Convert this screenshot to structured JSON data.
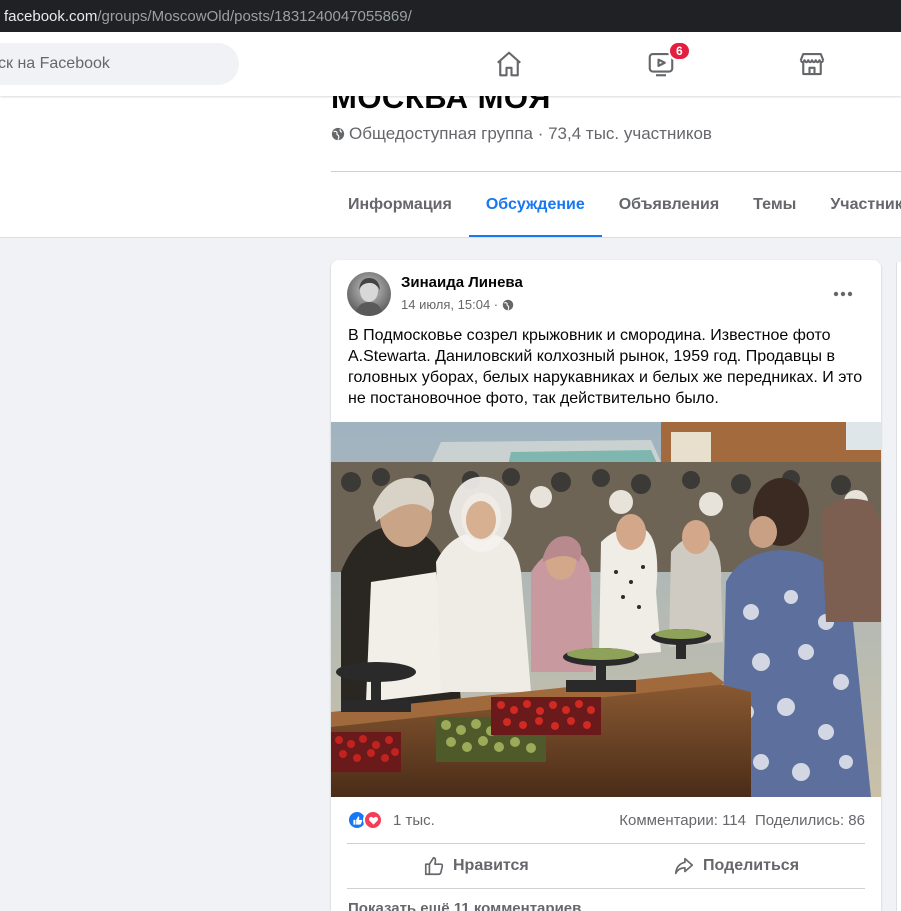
{
  "browser": {
    "url_host": "facebook.com",
    "url_path": "/groups/MoscowOld/posts/1831240047055869/"
  },
  "nav": {
    "search_placeholder": "ск на Facebook",
    "icons": [
      "home-icon",
      "watch-icon",
      "marketplace-icon"
    ],
    "watch_badge": "6"
  },
  "group": {
    "title": "МОСКВА МОЯ",
    "meta": "Общедоступная группа · 73,4 тыс. участников",
    "tabs": [
      {
        "label": "Информация",
        "active": false
      },
      {
        "label": "Обсуждение",
        "active": true
      },
      {
        "label": "Объявления",
        "active": false
      },
      {
        "label": "Темы",
        "active": false
      },
      {
        "label": "Участник",
        "active": false
      }
    ]
  },
  "post": {
    "author": "Зинаида Линева",
    "time": "14 июля, 15:04 ·",
    "text": "В Подмосковье созрел крыжовник и смородина. Известное фото A.Stewarta. Даниловский колхозный рынок, 1959 год. Продавцы в головных уборах, белых нарукавниках и белых же передниках. И это не постановочное фото, так действительно было.",
    "reactions_count": "1 тыс.",
    "comments": "Комментарии: 114",
    "shares": "Поделились: 86",
    "like_label": "Нравится",
    "share_label": "Поделиться",
    "more_comments": "Показать ещё 11 комментариев"
  },
  "colors": {
    "accent": "#1877f2",
    "badge": "#e41e3f",
    "like": "#1877f2",
    "love": "#f33e58"
  }
}
